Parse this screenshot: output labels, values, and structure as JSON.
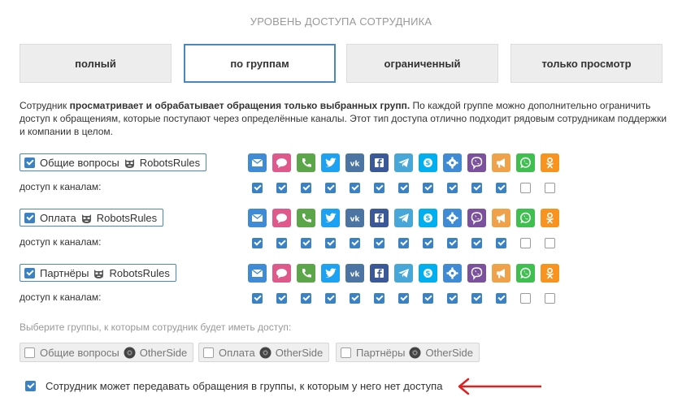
{
  "title": "УРОВЕНЬ ДОСТУПА СОТРУДНИКА",
  "levels": [
    {
      "label": "полный",
      "active": false
    },
    {
      "label": "по группам",
      "active": true
    },
    {
      "label": "ограниченный",
      "active": false
    },
    {
      "label": "только просмотр",
      "active": false
    }
  ],
  "description": {
    "prefix": "Сотрудник ",
    "bold": "просматривает и обрабатывает обращения только выбранных групп.",
    "suffix": " По каждой группе можно дополнительно ограничить доступ к обращениям, которые поступают через определённые каналы. Этот тип доступа отлично подходит рядовым сотрудникам поддержки и компании в целом."
  },
  "channels": [
    {
      "name": "email-icon",
      "color": "#3f8bd6"
    },
    {
      "name": "chat-icon",
      "color": "#e0598b"
    },
    {
      "name": "phone-icon",
      "color": "#5aa648"
    },
    {
      "name": "twitter-icon",
      "color": "#1da1f2"
    },
    {
      "name": "vk-icon",
      "color": "#4c75a3"
    },
    {
      "name": "facebook-icon",
      "color": "#3b5998"
    },
    {
      "name": "telegram-icon",
      "color": "#47a7d8"
    },
    {
      "name": "skype-icon",
      "color": "#00aff0"
    },
    {
      "name": "widget-icon",
      "color": "#3f8bd6"
    },
    {
      "name": "viber-icon",
      "color": "#7b519d"
    },
    {
      "name": "megaphone-icon",
      "color": "#f0a24a"
    },
    {
      "name": "whatsapp-icon",
      "color": "#3fbf4f"
    },
    {
      "name": "odnoklassniki-icon",
      "color": "#f7931e"
    }
  ],
  "access_label": "доступ к каналам:",
  "groups": [
    {
      "name": "Общие вопросы",
      "brand": "RobotsRules",
      "checked": true,
      "channels": [
        true,
        true,
        true,
        true,
        true,
        true,
        true,
        true,
        true,
        true,
        true,
        false,
        false
      ]
    },
    {
      "name": "Оплата",
      "brand": "RobotsRules",
      "checked": true,
      "channels": [
        true,
        true,
        true,
        true,
        true,
        true,
        true,
        true,
        true,
        true,
        true,
        false,
        false
      ]
    },
    {
      "name": "Партнёры",
      "brand": "RobotsRules",
      "checked": true,
      "channels": [
        true,
        true,
        true,
        true,
        true,
        true,
        true,
        true,
        true,
        true,
        true,
        false,
        false
      ]
    }
  ],
  "hint": "Выберите группы, к которым сотрудник будет иметь доступ:",
  "other_groups": [
    {
      "name": "Общие вопросы",
      "brand": "OtherSide"
    },
    {
      "name": "Оплата",
      "brand": "OtherSide"
    },
    {
      "name": "Партнёры",
      "brand": "OtherSide"
    }
  ],
  "transfer": {
    "label": "Сотрудник может передавать обращения в группы, к которым у него нет доступа",
    "checked": true
  },
  "colors": {
    "accent": "#3b82c4",
    "arrow": "#e02020"
  }
}
